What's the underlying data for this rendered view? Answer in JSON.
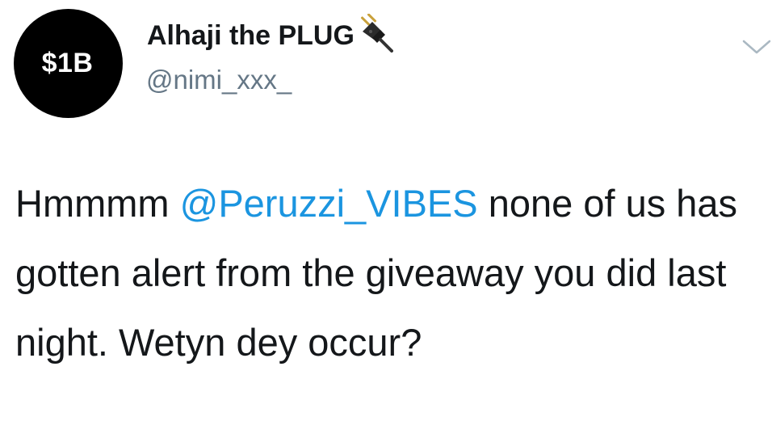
{
  "author": {
    "avatar_text": "$1B",
    "display_name": "Alhaji the PLUG",
    "name_emoji": "electric-plug-icon",
    "handle": "@nimi_xxx_"
  },
  "menu": {
    "icon": "chevron-down-icon"
  },
  "tweet": {
    "text_before": "Hmmmm ",
    "mention": "@Peruzzi_VIBES",
    "text_after": " none of us has gotten alert from the giveaway you did last night. Wetyn dey occur?"
  },
  "colors": {
    "text": "#14171a",
    "secondary": "#657786",
    "mention": "#1b95e0",
    "avatar_bg": "#000000"
  }
}
